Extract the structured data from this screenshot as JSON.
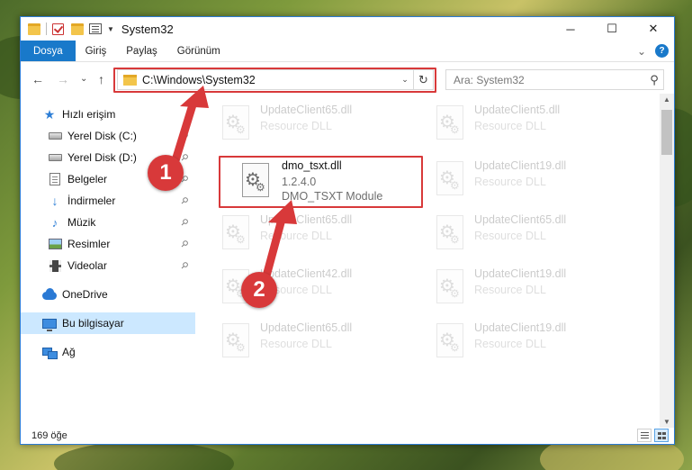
{
  "window": {
    "title": "System32",
    "controls": {
      "minimize": "─",
      "maximize": "☐",
      "close": "✕"
    }
  },
  "ribbon": {
    "tabs": [
      "Dosya",
      "Giriş",
      "Paylaş",
      "Görünüm"
    ],
    "expand_glyph": "⌄",
    "help_glyph": "?"
  },
  "nav": {
    "back": "←",
    "forward": "→",
    "recent": "⌄",
    "up": "↑",
    "address": "C:\\Windows\\System32",
    "address_dropdown": "⌄",
    "refresh": "↻",
    "search_placeholder": "Ara: System32",
    "search_glyph": "⚲"
  },
  "sidebar": {
    "items": [
      {
        "label": "Hızlı erişim",
        "icon": "star-icon",
        "pinned": false
      },
      {
        "label": "Yerel Disk (C:)",
        "icon": "drive-icon",
        "pinned": true
      },
      {
        "label": "Yerel Disk (D:)",
        "icon": "drive-icon",
        "pinned": true
      },
      {
        "label": "Belgeler",
        "icon": "documents-icon",
        "pinned": true
      },
      {
        "label": "İndirmeler",
        "icon": "download-icon",
        "pinned": true
      },
      {
        "label": "Müzik",
        "icon": "music-icon",
        "pinned": true
      },
      {
        "label": "Resimler",
        "icon": "pictures-icon",
        "pinned": true
      },
      {
        "label": "Videolar",
        "icon": "videos-icon",
        "pinned": true
      },
      {
        "label": "OneDrive",
        "icon": "onedrive-icon",
        "pinned": false
      },
      {
        "label": "Bu bilgisayar",
        "icon": "this-pc-icon",
        "pinned": false,
        "selected": true
      },
      {
        "label": "Ağ",
        "icon": "network-icon",
        "pinned": false
      }
    ],
    "pin_glyph": "📌"
  },
  "files": {
    "highlighted": {
      "name": "dmo_tsxt.dll",
      "version": "1.2.4.0",
      "description": "DMO_TSXT Module"
    },
    "background_left": [
      {
        "name": "UpdateClient65.dll",
        "type": "Resource DLL"
      },
      {
        "name": "UpdateClient65.dll",
        "type": "Resource DLL"
      },
      {
        "name": "UpdateClient42.dll",
        "type": "Resource DLL"
      },
      {
        "name": "UpdateClient65.dll",
        "type": "Resource DLL"
      }
    ],
    "background_right": [
      {
        "name": "UpdateClient5.dll",
        "type": "Resource DLL"
      },
      {
        "name": "UpdateClient19.dll",
        "type": "Resource DLL"
      },
      {
        "name": "UpdateClient65.dll",
        "type": "Resource DLL"
      },
      {
        "name": "UpdateClient19.dll",
        "type": "Resource DLL"
      },
      {
        "name": "UpdateClient19.dll",
        "type": "Resource DLL"
      }
    ]
  },
  "statusbar": {
    "item_count": "169 öğe"
  },
  "steps": {
    "step1": "1",
    "step2": "2"
  },
  "colors": {
    "accent": "#1979ca",
    "highlight": "#d8393a",
    "selection": "#cce8ff"
  }
}
